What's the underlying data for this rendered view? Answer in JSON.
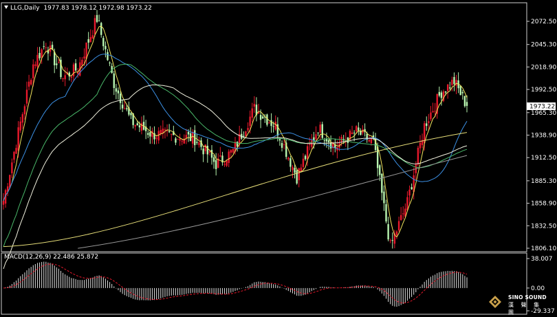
{
  "window": {
    "symbol_label": "LLG,Daily",
    "ohlc": "1977.83 1978.12 1972.98 1973.22"
  },
  "price_axis": {
    "labels": [
      "2072.50",
      "2045.30",
      "2018.90",
      "1992.50",
      "1965.30",
      "1938.90",
      "1912.50",
      "1885.30",
      "1858.90",
      "1832.50",
      "1806.10"
    ],
    "current_price": "1973.22"
  },
  "macd": {
    "label": "MACD(12,26,9) 22.486 25.872",
    "axis_labels": [
      "38.007",
      "0.00",
      "-29.337"
    ],
    "range": [
      -29.337,
      38.007
    ]
  },
  "logo": {
    "title": "SINO SOUND",
    "subtitle": "漢 聲 集 團"
  },
  "colors": {
    "background": "#000000",
    "bull_candle": "#e8192c",
    "bear_candle": "#b8f5b0",
    "ma_fast": "#f2e45c",
    "ma_mid": "#3c91e6",
    "ma_green": "#4ab86a",
    "ma_white": "#f2f2e0",
    "ma_yellow_long": "#e9e07a",
    "ma_gray": "#9a9a9a",
    "macd_hist": "#e0e0e0",
    "macd_signal": "#e8192c"
  },
  "chart_data": {
    "type": "candlestick",
    "title": "LLG,Daily",
    "ylim": [
      1806.1,
      2072.5
    ],
    "open": 1977.83,
    "high": 1978.12,
    "low": 1972.98,
    "close": 1973.22,
    "anchors": {
      "first_close": 1862,
      "early_high": 2047,
      "peak": 2076,
      "mid_high": 1970,
      "dip_low": 1890,
      "mid_recovery": 1948,
      "pre_crash": 1930,
      "crash_low": 1808,
      "recent_high": 2002,
      "last_close": 1973.22
    }
  }
}
